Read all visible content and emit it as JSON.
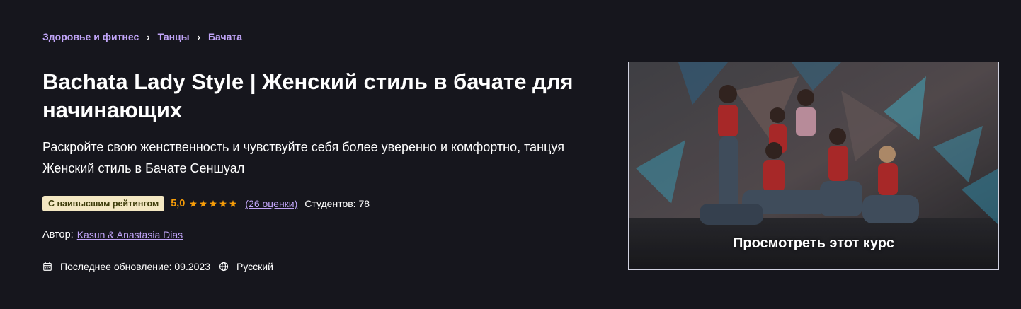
{
  "breadcrumb": {
    "items": [
      "Здоровье и фитнес",
      "Танцы",
      "Бачата"
    ],
    "separator": "›"
  },
  "course": {
    "title": "Bachata Lady Style | Женский стиль в бачате для начинающих",
    "subtitle": "Раскройте свою женственность и чувствуйте себя более уверенно и комфортно, танцуя Женский стиль в Бачате Сеншуал",
    "badge": "С наивысшим рейтингом",
    "rating": "5,0",
    "stars": 5,
    "rating_count": "(26 оценки)",
    "students": "Студентов: 78",
    "author_label": "Автор:",
    "author_name": "Kasun & Anastasia Dias",
    "last_updated": "Последнее обновление: 09.2023",
    "language": "Русский"
  },
  "preview": {
    "label": "Просмотреть этот курс"
  },
  "icons": {
    "calendar": "calendar-icon",
    "globe": "globe-icon",
    "star": "star-icon",
    "chevron": "chevron-right-icon"
  },
  "colors": {
    "background": "#16161d",
    "link": "#c0a4f7",
    "rating": "#f69c08",
    "badge_bg": "#f3e7c2",
    "badge_text": "#3d3c0a"
  }
}
